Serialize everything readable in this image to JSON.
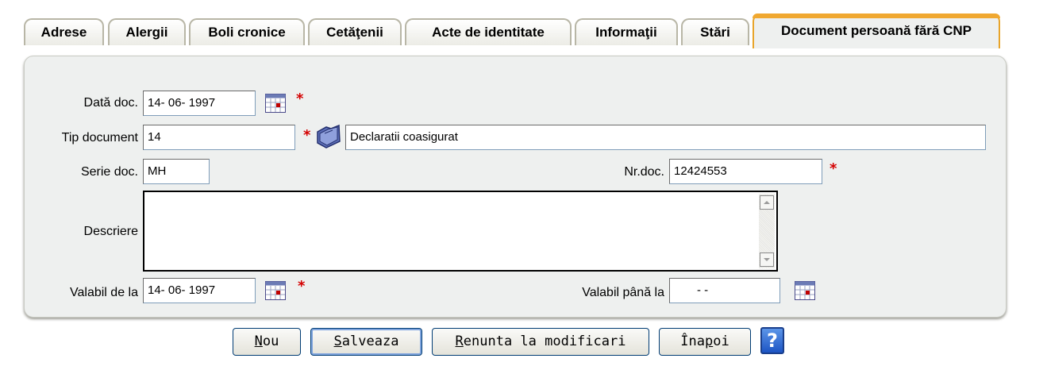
{
  "tabs": [
    {
      "label": "Adrese"
    },
    {
      "label": "Alergii"
    },
    {
      "label": "Boli cronice"
    },
    {
      "label": "Cetăţenii"
    },
    {
      "label": "Acte de identitate"
    },
    {
      "label": "Informaţii"
    },
    {
      "label": "Stări"
    },
    {
      "label": "Document persoană fără CNP",
      "active": true
    }
  ],
  "form": {
    "data_doc": {
      "label": "Dată doc.",
      "value": "14- 06-  1997",
      "required": "*"
    },
    "tip_document": {
      "label": "Tip document",
      "code": "14",
      "required": "*",
      "description": "Declaratii coasigurat"
    },
    "serie_doc": {
      "label": "Serie doc.",
      "value": "MH"
    },
    "nr_doc": {
      "label": "Nr.doc.",
      "value": "12424553",
      "required": "*"
    },
    "descriere": {
      "label": "Descriere",
      "value": ""
    },
    "valabil_de_la": {
      "label": "Valabil de la",
      "value": "14- 06-  1997",
      "required": "*"
    },
    "valabil_pana_la": {
      "label": "Valabil până la",
      "value": "-    -"
    }
  },
  "buttons": {
    "nou": {
      "first": "N",
      "rest": "ou"
    },
    "salveaza": {
      "first": "S",
      "rest": "alveaza"
    },
    "renunta": {
      "first": "R",
      "rest": "enunta la modificari"
    },
    "inapoi": {
      "pre": "Îna",
      "ul": "p",
      "post": "oi"
    },
    "help": "?"
  },
  "colors": {
    "active_tab_accent": "#f0a830",
    "required_star": "#d40000",
    "help_button": "#2a64d0"
  },
  "icons": [
    "calendar-icon",
    "folder-lookup-icon",
    "help-icon",
    "scroll-up-arrow-icon",
    "scroll-down-arrow-icon"
  ]
}
